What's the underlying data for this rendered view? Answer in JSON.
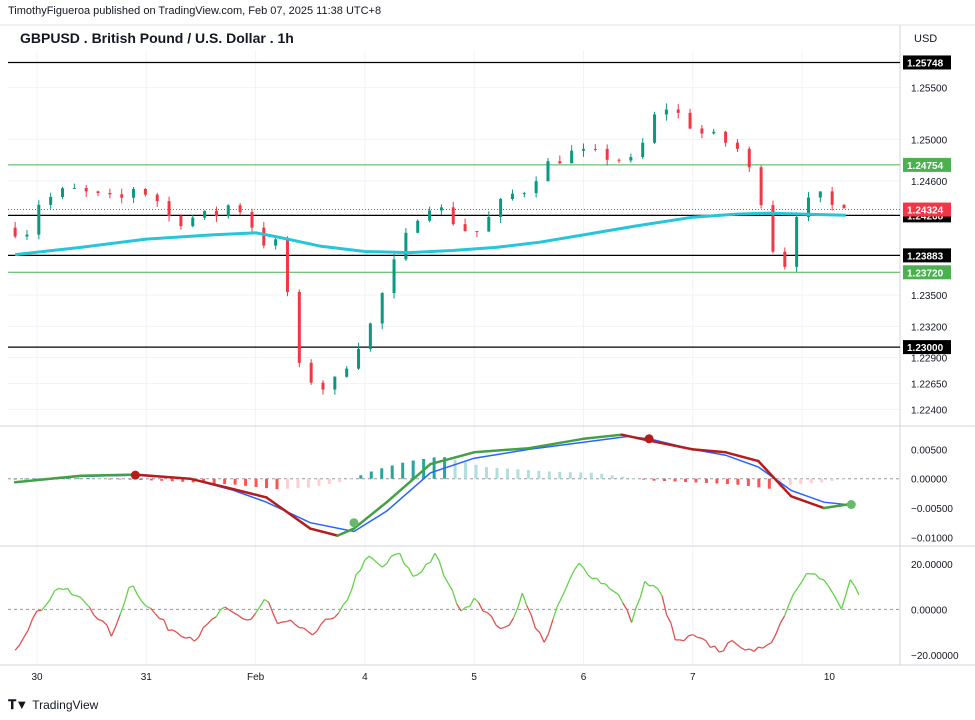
{
  "header": {
    "publisher": "TimothyFigueroa published on TradingView.com, Feb 07, 2025 11:38 UTC+8",
    "title": "GBPUSD . British Pound / U.S. Dollar . 1h",
    "currency": "USD"
  },
  "footer": {
    "brand": "TradingView",
    "logo": "tradingview-logo-icon"
  },
  "colors": {
    "up": "#089981",
    "down": "#f23645",
    "ma": "#26c6da",
    "macd_line": "#2962ff",
    "signal_up": "#43a047",
    "signal_down": "#b71c1c",
    "hist_pos_strong": "#26a69a",
    "hist_pos_weak": "#b2dfdb",
    "hist_neg_strong": "#ff5252",
    "hist_neg_weak": "#ffcdd2",
    "zone": "#fff3c4",
    "green_level": "#4caf50",
    "black_level": "#000000"
  },
  "chart_data": [
    {
      "type": "candlestick",
      "pane": "price",
      "y_ticks": [
        "1.25500",
        "1.25000",
        "1.24600",
        "1.23500",
        "1.23200",
        "1.22900",
        "1.22650",
        "1.22400"
      ],
      "x_ticks": [
        "30",
        "31",
        "Feb",
        "4",
        "5",
        "6",
        "7",
        "10"
      ],
      "ylim": [
        1.2225,
        1.2586
      ],
      "levels": [
        {
          "value": 1.2574,
          "label": "1.25748",
          "style": "black"
        },
        {
          "value": 1.24754,
          "label": "1.24754",
          "style": "green"
        },
        {
          "value": 1.24268,
          "label": "1.24268",
          "style": "black"
        },
        {
          "value": 1.23883,
          "label": "1.23883",
          "style": "black"
        },
        {
          "value": 1.2372,
          "label": "1.23720",
          "style": "green"
        },
        {
          "value": 1.23,
          "label": "1.23000",
          "style": "black"
        }
      ],
      "last_price": {
        "value": 1.24324,
        "label": "1.24324"
      },
      "zone": {
        "from": 1.2494,
        "to": 1.2502,
        "start_day": 29.82,
        "end_day": 5.97
      },
      "ma_line": [
        [
          29.8,
          1.2389
        ],
        [
          30.4,
          1.2396
        ],
        [
          31.0,
          1.2404
        ],
        [
          31.6,
          1.2408
        ],
        [
          32.0,
          1.241
        ],
        [
          32.2,
          1.2406
        ],
        [
          32.6,
          1.2397
        ],
        [
          33.0,
          1.2392
        ],
        [
          33.4,
          1.2391
        ],
        [
          33.8,
          1.2393
        ],
        [
          34.2,
          1.2396
        ],
        [
          34.6,
          1.2401
        ],
        [
          35.0,
          1.2408
        ],
        [
          35.5,
          1.2417
        ],
        [
          36.0,
          1.2425
        ],
        [
          36.4,
          1.2428
        ],
        [
          36.7,
          1.2429
        ],
        [
          37.0,
          1.2428
        ],
        [
          37.4,
          1.2427
        ]
      ],
      "ohlc_anchors": [
        [
          29.8,
          1.2415
        ],
        [
          29.95,
          1.2408
        ],
        [
          30.05,
          1.2438
        ],
        [
          30.35,
          1.2452
        ],
        [
          30.6,
          1.2445
        ],
        [
          30.8,
          1.244
        ],
        [
          30.95,
          1.2455
        ],
        [
          31.15,
          1.2442
        ],
        [
          31.3,
          1.242
        ],
        [
          31.5,
          1.2425
        ],
        [
          31.7,
          1.2428
        ],
        [
          31.85,
          1.244
        ],
        [
          32.0,
          1.2422
        ],
        [
          32.1,
          1.2398
        ],
        [
          32.2,
          1.2408
        ],
        [
          32.3,
          1.2385
        ],
        [
          32.45,
          1.228
        ],
        [
          32.65,
          1.226
        ],
        [
          32.8,
          1.2268
        ],
        [
          32.95,
          1.2296
        ],
        [
          33.1,
          1.232
        ],
        [
          33.3,
          1.2375
        ],
        [
          33.45,
          1.241
        ],
        [
          33.6,
          1.244
        ],
        [
          33.75,
          1.2432
        ],
        [
          33.9,
          1.2418
        ],
        [
          34.05,
          1.2408
        ],
        [
          34.2,
          1.2425
        ],
        [
          34.35,
          1.2445
        ],
        [
          34.5,
          1.245
        ],
        [
          34.7,
          1.2475
        ],
        [
          34.95,
          1.2487
        ],
        [
          35.2,
          1.2485
        ],
        [
          35.5,
          1.2478
        ],
        [
          35.65,
          1.2505
        ],
        [
          35.75,
          1.2535
        ],
        [
          35.95,
          1.2522
        ],
        [
          36.1,
          1.2507
        ],
        [
          36.3,
          1.25
        ],
        [
          36.45,
          1.2493
        ],
        [
          36.65,
          1.2455
        ],
        [
          36.8,
          1.239
        ],
        [
          36.9,
          1.238
        ],
        [
          37.0,
          1.243
        ],
        [
          37.2,
          1.2446
        ],
        [
          37.35,
          1.2434
        ],
        [
          37.45,
          1.244
        ]
      ]
    },
    {
      "type": "macd",
      "pane": "macd",
      "y_ticks": [
        "0.00500",
        "0.00000",
        "−0.00500",
        "−0.01000"
      ],
      "ylim": [
        -0.0113,
        0.0083
      ],
      "macd": [
        [
          29.8,
          -0.0006
        ],
        [
          30.4,
          0.0004
        ],
        [
          30.9,
          0.0006
        ],
        [
          31.4,
          0.0
        ],
        [
          31.8,
          -0.002
        ],
        [
          32.1,
          -0.004
        ],
        [
          32.5,
          -0.0075
        ],
        [
          32.9,
          -0.009
        ],
        [
          33.2,
          -0.0055
        ],
        [
          33.6,
          0.001
        ],
        [
          34.0,
          0.0035
        ],
        [
          34.5,
          0.005
        ],
        [
          35.0,
          0.0062
        ],
        [
          35.4,
          0.0072
        ],
        [
          35.6,
          0.0068
        ],
        [
          36.0,
          0.005
        ],
        [
          36.3,
          0.004
        ],
        [
          36.6,
          0.002
        ],
        [
          36.9,
          -0.002
        ],
        [
          37.2,
          -0.004
        ],
        [
          37.45,
          -0.0045
        ]
      ],
      "signal": [
        [
          29.8,
          -0.0006
        ],
        [
          30.4,
          0.0005
        ],
        [
          30.9,
          0.0007
        ],
        [
          31.4,
          0.0
        ],
        [
          31.8,
          -0.0018
        ],
        [
          32.1,
          -0.0032
        ],
        [
          32.5,
          -0.0085
        ],
        [
          32.75,
          -0.0097
        ],
        [
          32.9,
          -0.0085
        ],
        [
          33.2,
          -0.004
        ],
        [
          33.6,
          0.0025
        ],
        [
          34.0,
          0.0045
        ],
        [
          34.5,
          0.0052
        ],
        [
          35.0,
          0.0068
        ],
        [
          35.35,
          0.0075
        ],
        [
          35.6,
          0.0065
        ],
        [
          36.0,
          0.005
        ],
        [
          36.3,
          0.0045
        ],
        [
          36.6,
          0.003
        ],
        [
          36.9,
          -0.003
        ],
        [
          37.2,
          -0.005
        ],
        [
          37.45,
          -0.0043
        ]
      ],
      "cross_points": [
        {
          "day": 30.9,
          "value": 0.0006,
          "kind": "bearish"
        },
        {
          "day": 32.9,
          "value": -0.0075,
          "kind": "bullish"
        },
        {
          "day": 35.6,
          "value": 0.0068,
          "kind": "bearish"
        },
        {
          "day": 37.45,
          "value": -0.0044,
          "kind": "bullish"
        }
      ],
      "histogram_anchors": [
        [
          29.8,
          0.0
        ],
        [
          30.5,
          0.0001
        ],
        [
          31.2,
          -0.0004
        ],
        [
          31.8,
          -0.001
        ],
        [
          32.2,
          -0.0018
        ],
        [
          32.5,
          -0.0015
        ],
        [
          32.8,
          -0.0005
        ],
        [
          33.1,
          0.0015
        ],
        [
          33.4,
          0.003
        ],
        [
          33.7,
          0.0038
        ],
        [
          34.1,
          0.002
        ],
        [
          34.7,
          0.0012
        ],
        [
          35.1,
          0.001
        ],
        [
          35.3,
          0.0005
        ],
        [
          35.6,
          -0.0003
        ],
        [
          36.0,
          -0.0006
        ],
        [
          36.4,
          -0.001
        ],
        [
          36.7,
          -0.0017
        ],
        [
          36.95,
          -0.001
        ],
        [
          37.2,
          -0.0006
        ],
        [
          37.4,
          0.0
        ]
      ]
    },
    {
      "type": "line",
      "pane": "oscillator",
      "y_ticks": [
        "20.00000",
        "0.00000",
        "−20.00000"
      ],
      "ylim": [
        -24.5,
        27.0
      ],
      "zero_line": true,
      "anchors": [
        [
          29.8,
          -18
        ],
        [
          29.95,
          -5
        ],
        [
          30.2,
          10
        ],
        [
          30.45,
          3
        ],
        [
          30.7,
          -12
        ],
        [
          30.85,
          12
        ],
        [
          31.0,
          2
        ],
        [
          31.2,
          -8
        ],
        [
          31.45,
          -13
        ],
        [
          31.7,
          0
        ],
        [
          31.95,
          -5
        ],
        [
          32.1,
          5
        ],
        [
          32.2,
          -7
        ],
        [
          32.35,
          -6
        ],
        [
          32.5,
          -12
        ],
        [
          32.6,
          -6
        ],
        [
          32.75,
          -4
        ],
        [
          32.85,
          6
        ],
        [
          32.95,
          18
        ],
        [
          33.05,
          23
        ],
        [
          33.15,
          18
        ],
        [
          33.3,
          25
        ],
        [
          33.45,
          14
        ],
        [
          33.65,
          24
        ],
        [
          33.75,
          12
        ],
        [
          33.9,
          -2
        ],
        [
          34.0,
          6
        ],
        [
          34.15,
          -4
        ],
        [
          34.3,
          -10
        ],
        [
          34.45,
          8
        ],
        [
          34.55,
          -8
        ],
        [
          34.65,
          -14
        ],
        [
          34.8,
          5
        ],
        [
          34.95,
          20
        ],
        [
          35.1,
          14
        ],
        [
          35.3,
          8
        ],
        [
          35.45,
          -6
        ],
        [
          35.55,
          12
        ],
        [
          35.7,
          8
        ],
        [
          35.85,
          -15
        ],
        [
          36.0,
          -12
        ],
        [
          36.25,
          -18
        ],
        [
          36.4,
          -14
        ],
        [
          36.55,
          -20
        ],
        [
          36.75,
          -12
        ],
        [
          36.9,
          5
        ],
        [
          37.05,
          18
        ],
        [
          37.2,
          12
        ],
        [
          37.3,
          6
        ],
        [
          37.35,
          -1
        ],
        [
          37.45,
          13
        ],
        [
          37.52,
          5
        ]
      ]
    }
  ]
}
